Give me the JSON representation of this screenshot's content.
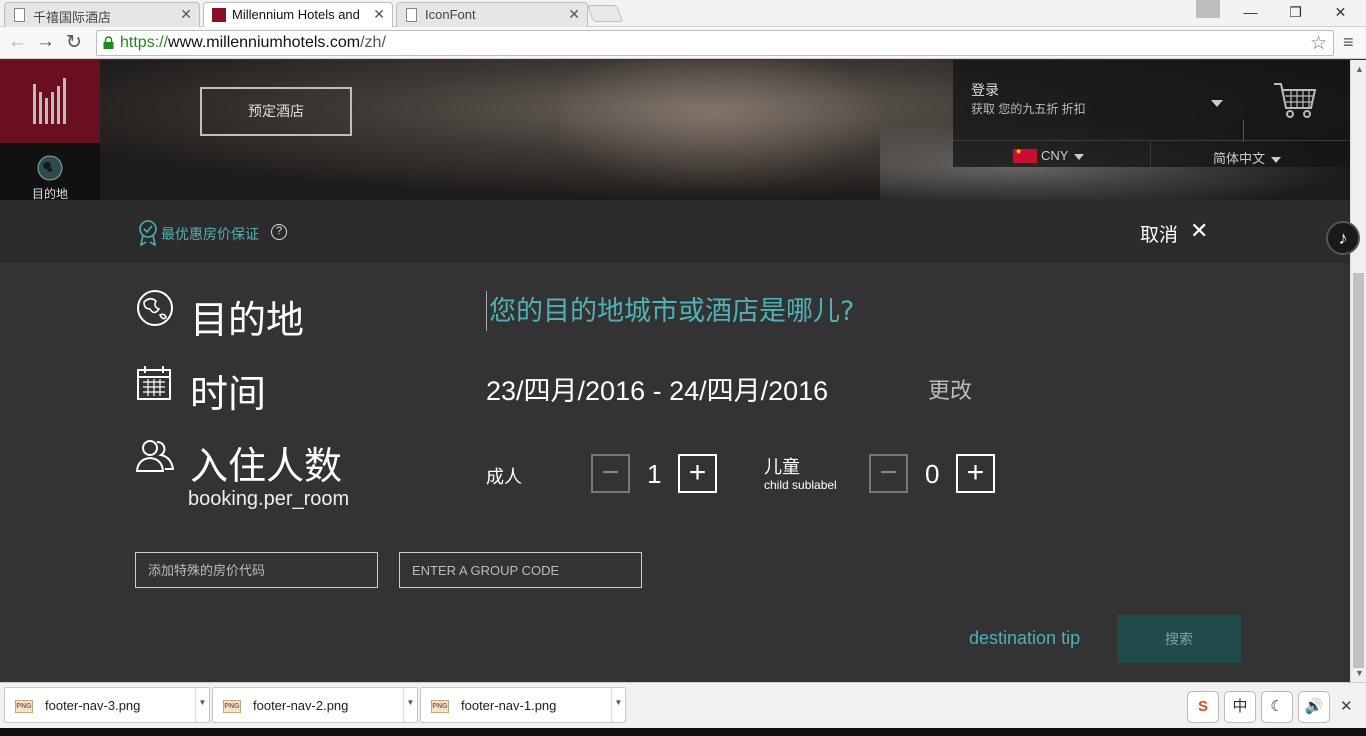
{
  "browser": {
    "tabs": [
      {
        "title": "千禧国际酒店",
        "active": false
      },
      {
        "title": "Millennium Hotels and Resorts",
        "active": true
      },
      {
        "title": "IconFont",
        "active": false
      }
    ],
    "url_scheme": "https://",
    "url_host": "www.millenniumhotels.com",
    "url_path": "/zh/"
  },
  "header": {
    "book_hotel": "预定酒店",
    "destination_side": "目的地",
    "login_title": "登录",
    "login_sub": "获取 您的九五折 折扣",
    "currency": "CNY",
    "language": "简体中文"
  },
  "guarantee": {
    "text": "最优惠房价保证",
    "cancel": "取消"
  },
  "form": {
    "destination_label": "目的地",
    "destination_placeholder": "您的目的地城市或酒店是哪儿?",
    "time_label": "时间",
    "dates": "23/四月/2016 - 24/四月/2016",
    "change": "更改",
    "guests_label": "入住人数",
    "guests_sublabel": "booking.per_room",
    "adults_label": "成人",
    "adults_value": "1",
    "children_label": "儿童",
    "children_sublabel": "child sublabel",
    "children_value": "0",
    "special_code_placeholder": "添加特殊的房价代码",
    "group_code_placeholder": "ENTER A GROUP CODE",
    "destination_tip": "destination tip",
    "search": "搜索"
  },
  "downloads": [
    {
      "name": "footer-nav-3.png"
    },
    {
      "name": "footer-nav-2.png"
    },
    {
      "name": "footer-nav-1.png"
    }
  ],
  "tray": {
    "ime_label": "中"
  },
  "colors": {
    "brand": "#6a0f20",
    "teal": "#4fb0b6",
    "search_bg": "#204a4c"
  }
}
